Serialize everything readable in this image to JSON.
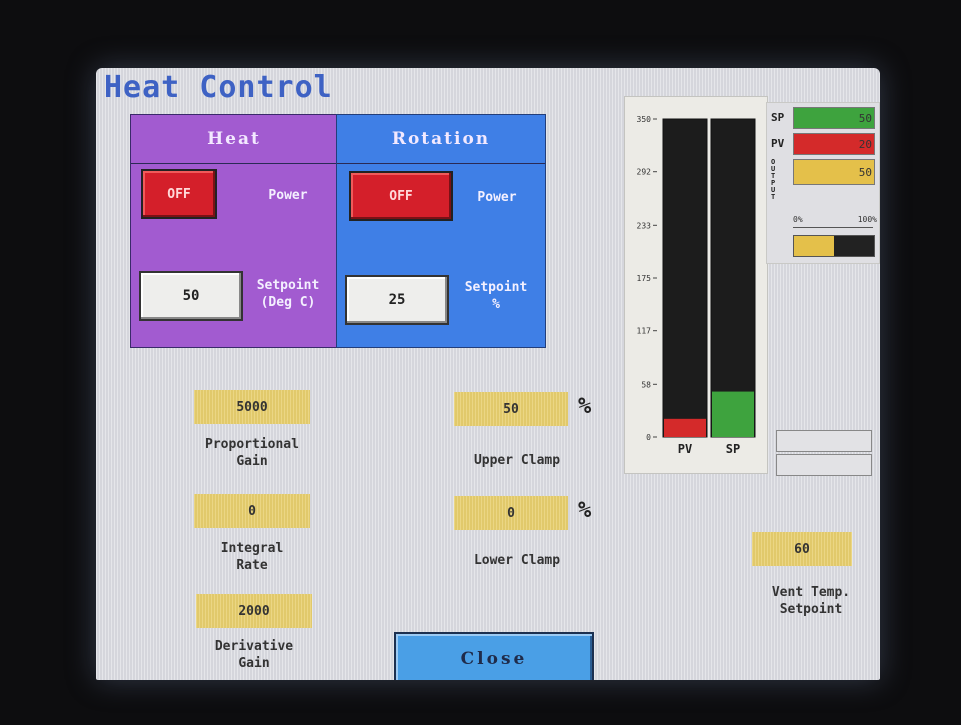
{
  "title": "Heat Control",
  "heat": {
    "header": "Heat",
    "power_button": "OFF",
    "power_label": "Power",
    "setpoint_value": "50",
    "setpoint_label_line1": "Setpoint",
    "setpoint_label_line2": "(Deg C)"
  },
  "rotation": {
    "header": "Rotation",
    "power_button": "OFF",
    "power_label": "Power",
    "setpoint_value": "25",
    "setpoint_label_line1": "Setpoint",
    "setpoint_label_line2": "%"
  },
  "params": {
    "proportional_gain_value": "5000",
    "proportional_gain_line1": "Proportional",
    "proportional_gain_line2": "Gain",
    "integral_rate_value": "0",
    "integral_rate_line1": "Integral",
    "integral_rate_line2": "Rate",
    "derivative_gain_value": "2000",
    "derivative_gain_line1": "Derivative",
    "derivative_gain_line2": "Gain",
    "upper_clamp_value": "50",
    "upper_clamp_label": "Upper Clamp",
    "lower_clamp_value": "0",
    "lower_clamp_label": "Lower Clamp",
    "percent_symbol": "%",
    "vent_temp_value": "60",
    "vent_temp_line1": "Vent Temp.",
    "vent_temp_line2": "Setpoint"
  },
  "legend": {
    "sp_label": "SP",
    "sp_value": "50",
    "pv_label": "PV",
    "pv_value": "20",
    "output_label": "OUTPUT",
    "output_value": "50",
    "scale_min": "0%",
    "scale_max": "100%",
    "output_fraction": 0.5,
    "colors": {
      "sp": "#3ea33e",
      "pv": "#d42a2a",
      "output": "#e4c04a"
    }
  },
  "chart_data": {
    "type": "bar",
    "categories": [
      "PV",
      "SP"
    ],
    "values": [
      20,
      50
    ],
    "colors": [
      "#d42a2a",
      "#3ea33e"
    ],
    "ylim": [
      0,
      350
    ],
    "yticks": [
      "0",
      "58",
      "117",
      "175",
      "233",
      "292",
      "350"
    ],
    "ytick_values": [
      0,
      58,
      117,
      175,
      233,
      292,
      350
    ]
  },
  "close_button": "Close"
}
